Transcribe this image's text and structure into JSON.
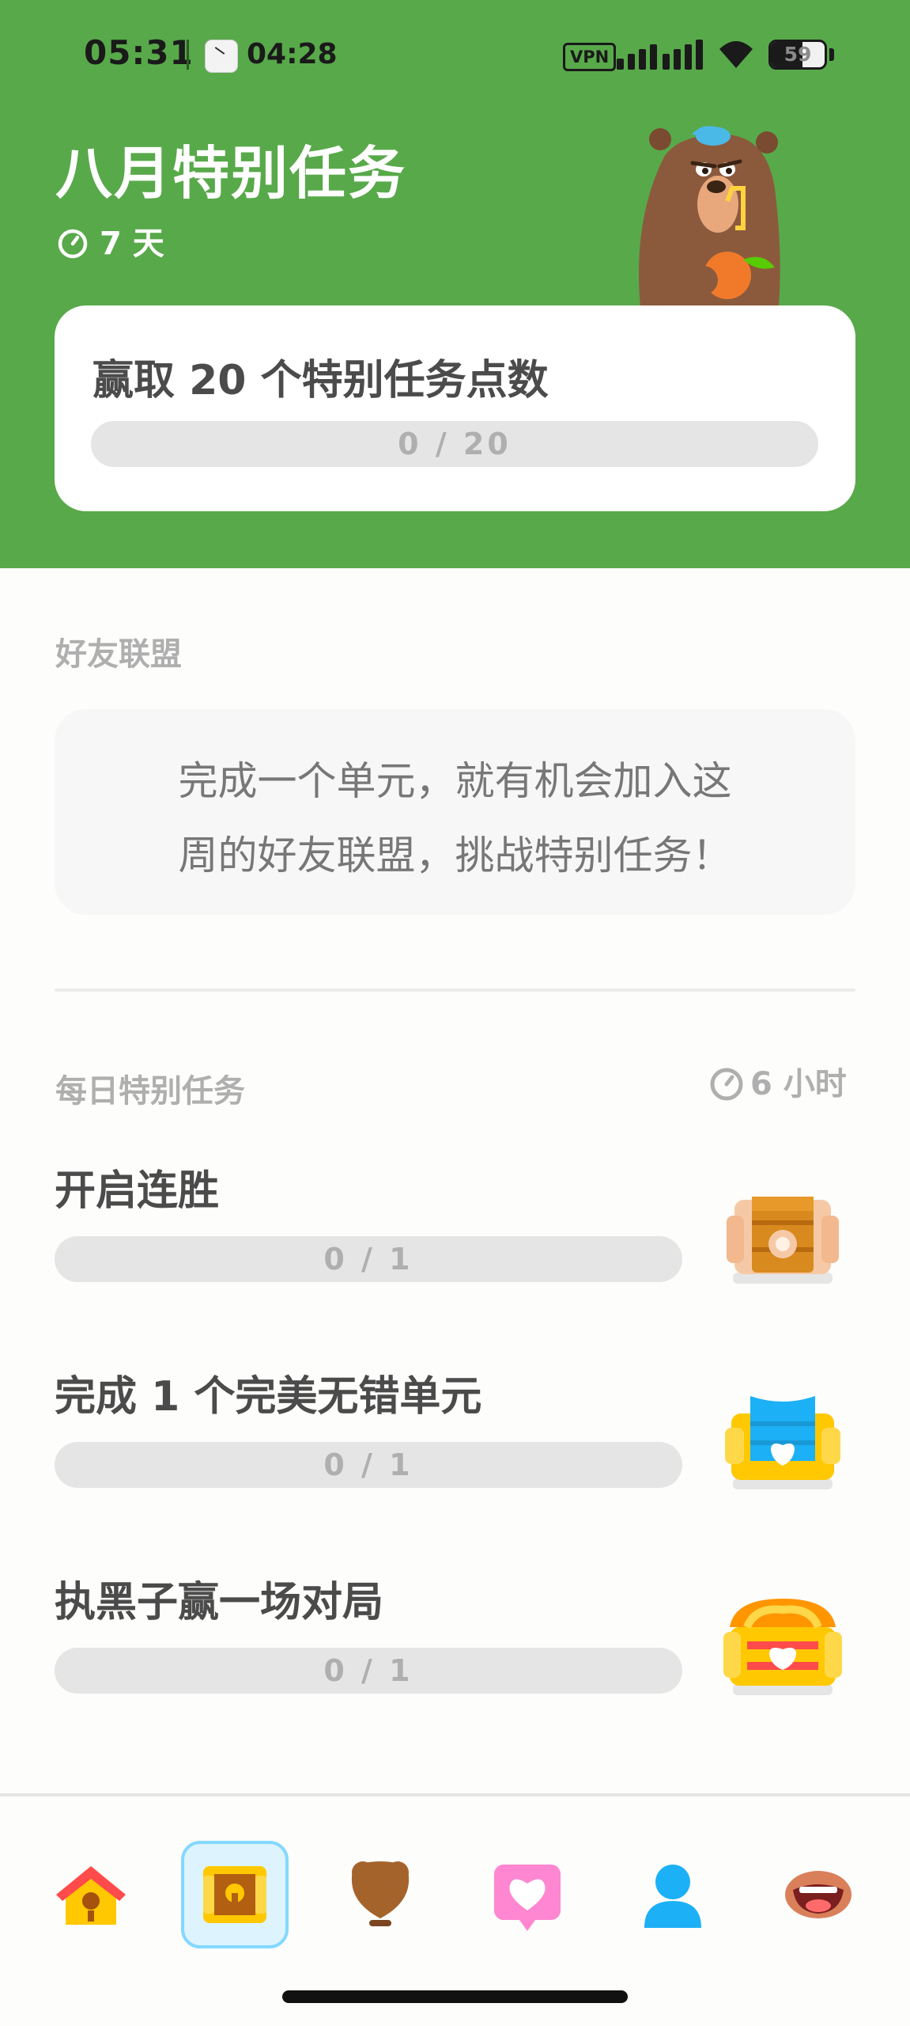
{
  "status_bar": {
    "time": "05:31",
    "timer": "04:28",
    "vpn": "VPN",
    "battery": "59",
    "battery_level": 0.59
  },
  "header": {
    "title": "八月特别任务",
    "days_left": "7 天",
    "monthly_goal": {
      "title": "赢取 20 个特别任务点数",
      "progress_text": "0 / 20",
      "progress": 0
    }
  },
  "friends": {
    "section_label": "好友联盟",
    "message_line1": "完成一个单元，就有机会加入这",
    "message_line2": "周的好友联盟，挑战特别任务！"
  },
  "daily": {
    "section_label": "每日特别任务",
    "time_left": "6 小时",
    "quests": [
      {
        "title": "开启连胜",
        "progress_text": "0 / 1",
        "progress": 0,
        "reward": "bronze-chest-icon"
      },
      {
        "title": "完成 1 个完美无错单元",
        "progress_text": "0 / 1",
        "progress": 0,
        "reward": "silver-chest-icon"
      },
      {
        "title": "执黑子赢一场对局",
        "progress_text": "0 / 1",
        "progress": 0,
        "reward": "gold-chest-icon"
      }
    ]
  },
  "nav": {
    "items": [
      "home-icon",
      "quests-chest-icon",
      "leaderboard-shield-icon",
      "friends-heart-icon",
      "profile-icon",
      "more-icon"
    ],
    "active": "quests-chest-icon"
  },
  "colors": {
    "header_green": "#58A94A",
    "progress_track": "#E5E5E5",
    "progress_fill": "#FFC800",
    "text_dark": "#4B4B4B",
    "text_muted": "#AFAFAF",
    "nav_active_bg": "#DDF4FF",
    "nav_active_border": "#84D8FF"
  }
}
